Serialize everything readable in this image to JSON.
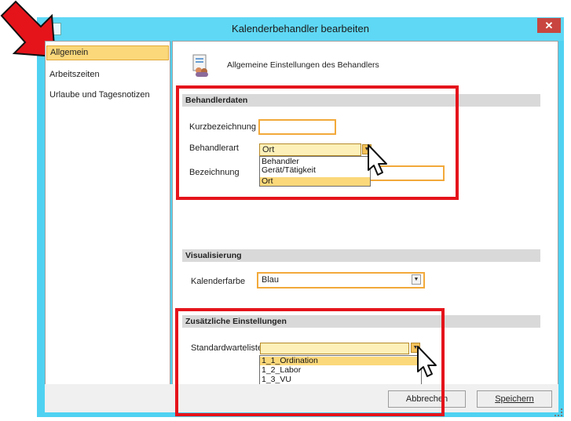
{
  "window": {
    "title": "Kalenderbehandler bearbeiten",
    "close_glyph": "✕"
  },
  "sidebar": {
    "items": [
      {
        "label": "Allgemein",
        "selected": true
      },
      {
        "label": "Arbeitszeiten",
        "selected": false
      },
      {
        "label": "Urlaube und Tagesnotizen",
        "selected": false
      }
    ]
  },
  "header": {
    "icon": "settings-people-icon",
    "text": "Allgemeine Einstellungen des Behandlers"
  },
  "behandlerdaten": {
    "section_title": "Behandlerdaten",
    "kurz_label": "Kurzbezeichnung",
    "kurz_value": "",
    "art_label": "Behandlerart",
    "art_value": "Ort",
    "art_options": [
      "Behandler",
      "Gerät/Tätigkeit",
      "Ort"
    ],
    "bez_label": "Bezeichnung",
    "bez_value": ""
  },
  "visualisierung": {
    "section_title": "Visualisierung",
    "farbe_label": "Kalenderfarbe",
    "farbe_value": "Blau"
  },
  "zusatz": {
    "section_title": "Zusätzliche Einstellungen",
    "warteliste_label": "Standardwarteliste",
    "warteliste_value": "",
    "warteliste_options": [
      "1_1_Ordination",
      "1_2_Labor",
      "1_3_VU"
    ]
  },
  "footer": {
    "cancel_label": "Abbrechen",
    "save_label": "Speichern"
  },
  "colors": {
    "window_frame": "#4fd2f2",
    "highlight": "#fbd87a",
    "annotation_red": "#e5141b",
    "arrow_red": "#e5141b"
  },
  "annotations": [
    "red-arrow-icon",
    "cursor-pointer-icon"
  ]
}
